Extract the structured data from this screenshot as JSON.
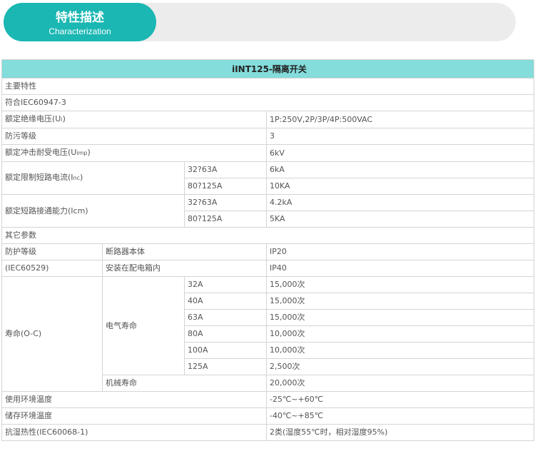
{
  "banner": {
    "title_cn": "特性描述",
    "title_en": "Characterization"
  },
  "table": {
    "title": "iINT125-隔离开关",
    "main_section": "主要特性",
    "standard": "符合IEC60947-3",
    "insulation_voltage": {
      "label": "额定绝缘电压(U",
      "sub": "i",
      "label_end": ")",
      "value": "1P:250V,2P/3P/4P:500VAC"
    },
    "pollution_degree": {
      "label": "防污等级",
      "value": "3"
    },
    "impulse_voltage": {
      "label": "额定冲击耐受电压(U",
      "sub": "imp",
      "label_end": ")",
      "value": "6kV"
    },
    "short_circuit_current": {
      "label": "额定限制短路电流(I",
      "sub": "nc",
      "label_end": ")",
      "rows": [
        {
          "range": "32?63A",
          "value": "6kA"
        },
        {
          "range": "80?125A",
          "value": "10KA"
        }
      ]
    },
    "making_capacity": {
      "label": "额定短路接通能力(Icm)",
      "rows": [
        {
          "range": "32?63A",
          "value": "4.2kA"
        },
        {
          "range": "80?125A",
          "value": "5KA"
        }
      ]
    },
    "other_section": "其它参数",
    "protection": {
      "label1": "防护等级",
      "label2": "(IEC60529)",
      "rows": [
        {
          "item": "断路器本体",
          "value": "IP20"
        },
        {
          "item": "安装在配电箱内",
          "value": "IP40"
        }
      ]
    },
    "life": {
      "label": "寿命(O-C)",
      "electrical_label": "电气寿命",
      "electrical": [
        {
          "rating": "32A",
          "value": "15,000次"
        },
        {
          "rating": "40A",
          "value": "15,000次"
        },
        {
          "rating": "63A",
          "value": "15,000次"
        },
        {
          "rating": "80A",
          "value": "10,000次"
        },
        {
          "rating": "100A",
          "value": "10,000次"
        },
        {
          "rating": "125A",
          "value": "2,500次"
        }
      ],
      "mechanical_label": "机械寿命",
      "mechanical_value": "20,000次"
    },
    "operating_temp": {
      "label": "使用环境温度",
      "value": "-25℃~+60℃"
    },
    "storage_temp": {
      "label": "储存环境温度",
      "value": "-40℃~+85℃"
    },
    "damp_heat": {
      "label": "抗湿热性(IEC60068-1)",
      "value": "2类(湿度55℃时，相对湿度95%)"
    }
  }
}
